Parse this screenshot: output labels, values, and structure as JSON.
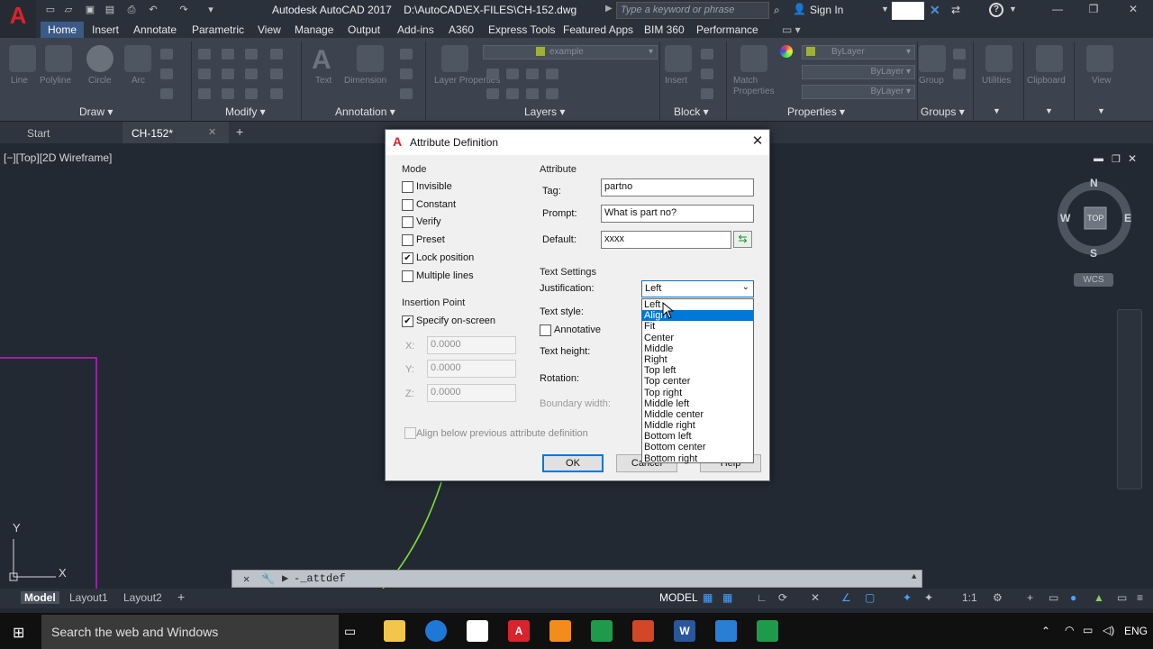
{
  "titlebar": {
    "app_title": "Autodesk AutoCAD 2017",
    "file_path": "D:\\AutoCAD\\EX-FILES\\CH-152.dwg",
    "search_placeholder": "Type a keyword or phrase",
    "signin": "Sign In"
  },
  "ribbon": {
    "tabs": [
      "Home",
      "Insert",
      "Annotate",
      "Parametric",
      "View",
      "Manage",
      "Output",
      "Add-ins",
      "A360",
      "Express Tools",
      "Featured Apps",
      "BIM 360",
      "Performance"
    ],
    "panels": [
      "Draw",
      "Modify",
      "Annotation",
      "Layers",
      "Block",
      "Properties",
      "Groups"
    ],
    "tools": [
      "Line",
      "Polyline",
      "Circle",
      "Arc",
      "Text",
      "Dimension",
      "Layer Properties",
      "Insert",
      "Match Properties",
      "Group",
      "Utilities",
      "Clipboard",
      "View"
    ],
    "layer_name": "example",
    "bylayer": [
      "ByLayer",
      "ByLayer",
      "ByLayer"
    ]
  },
  "filetabs": {
    "start": "Start",
    "active": "CH-152*"
  },
  "viewport": {
    "label": "[−][Top][2D Wireframe]"
  },
  "compass": {
    "n": "N",
    "s": "S",
    "e": "E",
    "w": "W",
    "top": "TOP",
    "wcs": "WCS"
  },
  "dialog": {
    "title": "Attribute Definition",
    "mode": {
      "heading": "Mode",
      "items": [
        {
          "label": "Invisible",
          "checked": false
        },
        {
          "label": "Constant",
          "checked": false
        },
        {
          "label": "Verify",
          "checked": false
        },
        {
          "label": "Preset",
          "checked": false
        },
        {
          "label": "Lock position",
          "checked": true
        },
        {
          "label": "Multiple lines",
          "checked": false
        }
      ]
    },
    "insertion": {
      "heading": "Insertion Point",
      "specify_label": "Specify on-screen",
      "x_label": "X:",
      "x": "0.0000",
      "y_label": "Y:",
      "y": "0.0000",
      "z_label": "Z:",
      "z": "0.0000"
    },
    "attribute": {
      "heading": "Attribute",
      "tag_label": "Tag:",
      "tag": "partno",
      "prompt_label": "Prompt:",
      "prompt": "What is part no?",
      "default_label": "Default:",
      "default": "xxxx"
    },
    "text_settings": {
      "heading": "Text Settings",
      "justification_label": "Justification:",
      "justification": "Left",
      "text_style_label": "Text style:",
      "annotative_label": "Annotative",
      "text_height_label": "Text height:",
      "rotation_label": "Rotation:",
      "boundary_label": "Boundary width:"
    },
    "justification_options": [
      "Left",
      "Align",
      "Fit",
      "Center",
      "Middle",
      "Right",
      "Top left",
      "Top center",
      "Top right",
      "Middle left",
      "Middle center",
      "Middle right",
      "Bottom left",
      "Bottom center",
      "Bottom right"
    ],
    "highlighted_option": "Align",
    "align_below": "Align below previous attribute definition",
    "buttons": {
      "ok": "OK",
      "cancel": "Cancel",
      "help": "Help"
    }
  },
  "command": {
    "text": "_attdef"
  },
  "layouts": [
    "Model",
    "Layout1",
    "Layout2"
  ],
  "status": {
    "model": "MODEL",
    "scale": "1:1"
  },
  "taskbar": {
    "search": "Search the web and Windows",
    "lang": "ENG"
  },
  "colors": {
    "accent": "#0078d7",
    "ribbon_tab_active": "#3b5a86",
    "drawing_bg": "#222933",
    "rectangle": "#c51fc5",
    "curve": "#7fe034"
  }
}
